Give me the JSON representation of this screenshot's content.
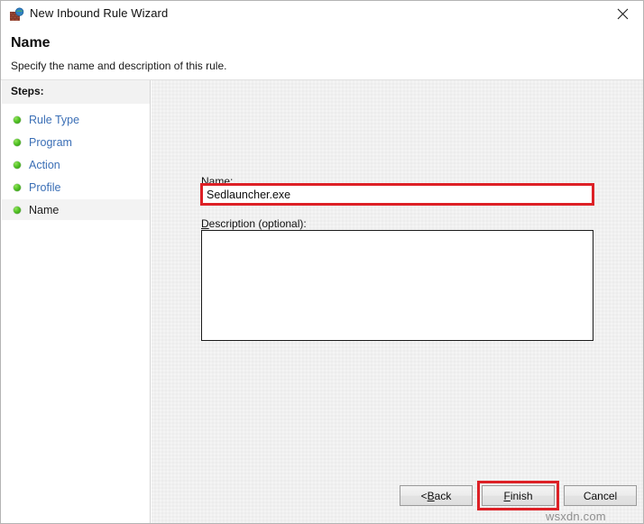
{
  "window": {
    "title": "New Inbound Rule Wizard",
    "icon": "firewall-globe-icon",
    "close_label": "✕"
  },
  "header": {
    "title": "Name",
    "subtitle": "Specify the name and description of this rule."
  },
  "sidebar": {
    "header": "Steps:",
    "items": [
      {
        "label": "Rule Type",
        "state": "complete"
      },
      {
        "label": "Program",
        "state": "complete"
      },
      {
        "label": "Action",
        "state": "complete"
      },
      {
        "label": "Profile",
        "state": "complete"
      },
      {
        "label": "Name",
        "state": "current"
      }
    ]
  },
  "form": {
    "name_label_accel": "N",
    "name_label_rest": "ame:",
    "name_value": "Sedlauncher.exe",
    "name_placeholder": "",
    "description_label_accel": "D",
    "description_label_rest": "escription (optional):",
    "description_value": "",
    "description_placeholder": ""
  },
  "buttons": {
    "back_prefix": "< ",
    "back_accel": "B",
    "back_rest": "ack",
    "finish_accel": "F",
    "finish_rest": "inish",
    "cancel": "Cancel"
  },
  "watermark": "wsxdn.com",
  "colors": {
    "highlight_red": "#dd2026",
    "link_blue": "#3b6fb6",
    "step_green": "#53c326",
    "content_gray": "#f0f0f0"
  }
}
